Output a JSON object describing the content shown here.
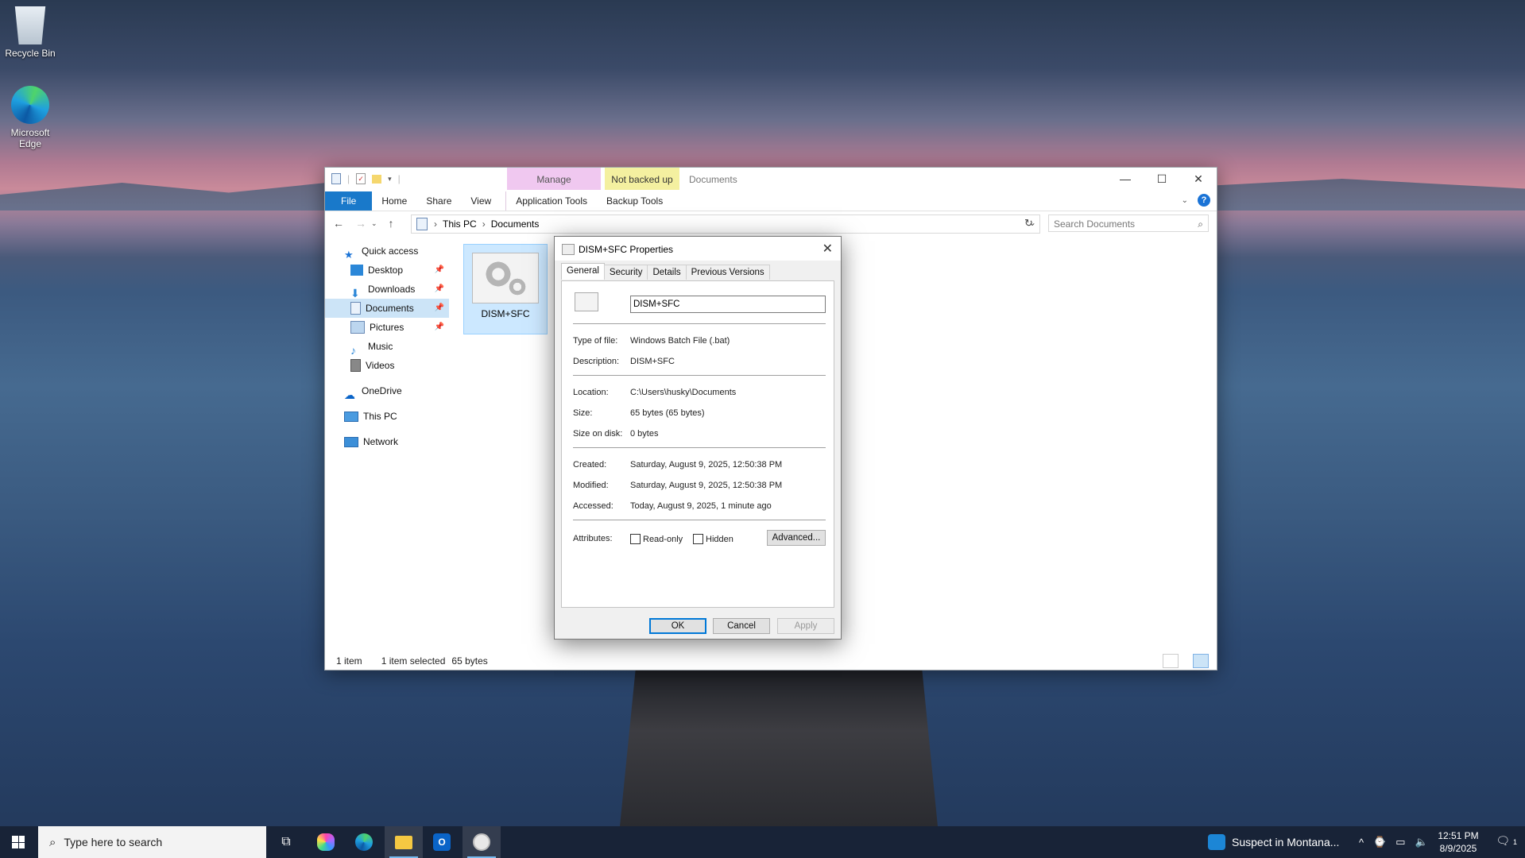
{
  "desktop": {
    "icons": [
      {
        "label": "Recycle Bin",
        "icon": "recycle-bin-icon"
      },
      {
        "label": "Microsoft Edge",
        "icon": "edge-icon"
      }
    ]
  },
  "explorer": {
    "title": "Documents",
    "context_tabs": {
      "manage": "Manage",
      "not_backed_up": "Not backed up"
    },
    "ribbon_tabs": [
      "File",
      "Home",
      "Share",
      "View",
      "Application Tools",
      "Backup Tools"
    ],
    "address": {
      "root": "This PC",
      "current": "Documents"
    },
    "search_placeholder": "Search Documents",
    "nav": {
      "quick_access": "Quick access",
      "items": [
        "Desktop",
        "Downloads",
        "Documents",
        "Pictures",
        "Music",
        "Videos"
      ],
      "onedrive": "OneDrive",
      "this_pc": "This PC",
      "network": "Network"
    },
    "file": {
      "name": "DISM+SFC"
    },
    "status": {
      "count": "1 item",
      "selected": "1 item selected",
      "size": "65 bytes"
    }
  },
  "dialog": {
    "title": "DISM+SFC Properties",
    "tabs": [
      "General",
      "Security",
      "Details",
      "Previous Versions"
    ],
    "name_value": "DISM+SFC",
    "fields": {
      "type_label": "Type of file:",
      "type_value": "Windows Batch File (.bat)",
      "desc_label": "Description:",
      "desc_value": "DISM+SFC",
      "location_label": "Location:",
      "location_value": "C:\\Users\\husky\\Documents",
      "size_label": "Size:",
      "size_value": "65 bytes (65 bytes)",
      "disk_label": "Size on disk:",
      "disk_value": "0 bytes",
      "created_label": "Created:",
      "created_value": "Saturday, August 9, 2025, 12:50:38 PM",
      "modified_label": "Modified:",
      "modified_value": "Saturday, August 9, 2025, 12:50:38 PM",
      "accessed_label": "Accessed:",
      "accessed_value": "Today, August 9, 2025, 1 minute ago",
      "attributes_label": "Attributes:"
    },
    "readonly_label": "Read-only",
    "hidden_label": "Hidden",
    "advanced_label": "Advanced...",
    "ok_label": "OK",
    "cancel_label": "Cancel",
    "apply_label": "Apply"
  },
  "taskbar": {
    "search_placeholder": "Type here to search",
    "weather_text": "Suspect in Montana...",
    "time": "12:51 PM",
    "date": "8/9/2025",
    "notification_count": "1"
  }
}
